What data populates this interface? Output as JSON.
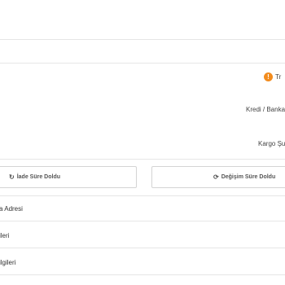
{
  "order": {
    "status_text": "Tr",
    "payment_method": "Kredi / Banka",
    "shipping_info": "Kargo Şu"
  },
  "actions": {
    "return_label": "İade Süre Doldu",
    "exchange_label": "Değişim Süre Doldu"
  },
  "sections": [
    {
      "label": "a Adresi"
    },
    {
      "label": "ileri"
    },
    {
      "label": "ilgileri"
    }
  ],
  "colors": {
    "status_accent": "#f28c1e",
    "divider": "#e6e6e6"
  },
  "icons": {
    "status": "exclamation-circle-icon",
    "return": "undo-icon",
    "exchange": "refresh-icon"
  }
}
